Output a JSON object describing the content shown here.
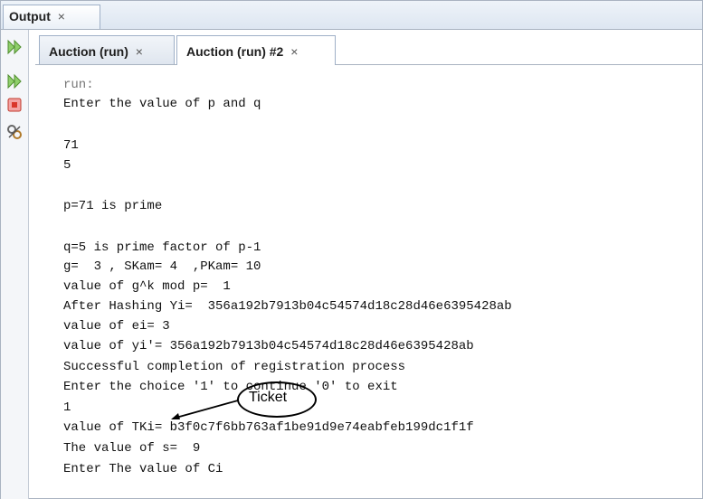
{
  "output_panel": {
    "title": "Output",
    "close": "×"
  },
  "run_tabs": [
    {
      "label": "Auction (run)",
      "close": "×"
    },
    {
      "label": "Auction (run) #2",
      "close": "×"
    }
  ],
  "console_lines": [
    "run:",
    "Enter the value of p and q",
    "71",
    "5",
    "p=71 is prime",
    "q=5 is prime factor of p-1",
    "g=  3 , SKam= 4  ,PKam= 10",
    "value of g^k mod p=  1",
    "After Hashing Yi=  356a192b7913b04c54574d18c28d46e6395428ab",
    "value of ei= 3",
    "value of yi'= 356a192b7913b04c54574d18c28d46e6395428ab",
    "Successful completion of registration process",
    "Enter the choice '1' to continue '0' to exit",
    "1",
    "value of TKi= b3f0c7f6bb763af1be91d9e74eabfeb199dc1f1f",
    "The value of s=  9",
    "Enter The value of Ci"
  ],
  "annotation": {
    "label": "Ticket"
  },
  "icons": [
    "rerun-icon",
    "rerun-with-options-icon",
    "stop-icon",
    "settings-icon"
  ]
}
